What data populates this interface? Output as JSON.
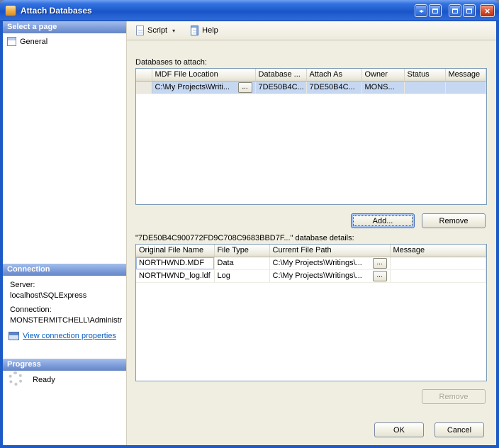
{
  "colors": {
    "frame": "#1D5AC6",
    "titlebar_top": "#6FA0F2",
    "titlebar_bottom": "#1A55C8",
    "sidebar_header": "#7D9DDB",
    "row_selection": "#C6D7F2",
    "link": "#0B5FBF",
    "close_button": "#CC3F1E"
  },
  "window": {
    "title": "Attach Databases",
    "controls": {
      "arrows_glyph": "◂▸",
      "close_glyph": "×"
    }
  },
  "sidebar": {
    "select_page_header": "Select a page",
    "general_item": "General",
    "connection_header": "Connection",
    "server_label": "Server:",
    "server_value": "localhost\\SQLExpress",
    "connection_label": "Connection:",
    "connection_value": "MONSTERMITCHELL\\Administra",
    "view_connection_link": "View connection properties",
    "progress_header": "Progress",
    "progress_status": "Ready"
  },
  "toolbar": {
    "script_label": "Script",
    "script_dropdown_glyph": "▾",
    "help_label": "Help"
  },
  "main": {
    "databases_to_attach_label": "Databases to attach:",
    "attach_table": {
      "headers": [
        "",
        "MDF File Location",
        "Database ...",
        "Attach As",
        "Owner",
        "Status",
        "Message"
      ],
      "rows": [
        {
          "mdf_location": "C:\\My Projects\\Writi...",
          "browse": "...",
          "database_name": "7DE50B4C...",
          "attach_as": "7DE50B4C...",
          "owner": "MONS...",
          "status": "",
          "message": ""
        }
      ]
    },
    "add_button": "Add...",
    "remove_button": "Remove",
    "details_label": "\"7DE50B4C900772FD9C708C9683BBD7F...\" database details:",
    "details_table": {
      "headers": [
        "Original File Name",
        "File Type",
        "Current File Path",
        "Message"
      ],
      "rows": [
        {
          "original_file_name": "NORTHWND.MDF",
          "file_type": "Data",
          "current_file_path": "C:\\My Projects\\Writings\\...",
          "browse": "...",
          "message": ""
        },
        {
          "original_file_name": "NORTHWND_log.ldf",
          "file_type": "Log",
          "current_file_path": "C:\\My Projects\\Writings\\...",
          "browse": "...",
          "message": ""
        }
      ]
    },
    "remove_details_button": "Remove",
    "ok_button": "OK",
    "cancel_button": "Cancel"
  }
}
